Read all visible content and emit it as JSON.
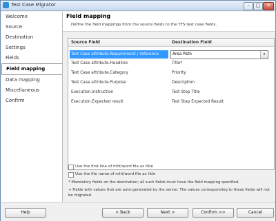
{
  "window": {
    "title": "Test Case Migrator"
  },
  "titlebar_buttons": {
    "minimize": "–",
    "maximize": "□",
    "close": "✕"
  },
  "sidebar": {
    "items": [
      {
        "label": "Welcome"
      },
      {
        "label": "Source"
      },
      {
        "label": "Destination"
      },
      {
        "label": "Settings"
      },
      {
        "label": "Fields"
      },
      {
        "label": "Field mapping",
        "active": true
      },
      {
        "label": "Data mapping"
      },
      {
        "label": "Miscellaneous"
      },
      {
        "label": "Confirm"
      }
    ]
  },
  "header": {
    "title": "Field mapping",
    "description": "Define the field mappings from the source fields to the TFS test case fields."
  },
  "grid": {
    "columns": [
      "Source Field",
      "Destination Field"
    ],
    "rows": [
      {
        "source": "Test Case attribute.Requirement / reference",
        "destination": "Area Path",
        "selected": true
      },
      {
        "source": "Test Case attribute.Headline",
        "destination": "Title*"
      },
      {
        "source": "Test Case attribute.Category",
        "destination": "Priority"
      },
      {
        "source": "Test Case attribute.Purpose",
        "destination": "Description"
      },
      {
        "source": "Execution.Instruction",
        "destination": "Test Step Title"
      },
      {
        "source": "Execution.Expected result",
        "destination": "Test Step Expected Result"
      }
    ],
    "dropdown_arrow": "▾"
  },
  "options": {
    "first_line_title": "Use the first line of mht/word file as title",
    "file_name_title": "Use the file name of mht/word file as title"
  },
  "notes": {
    "mandatory": "* Mandatory fields on the destination; all such fields must have the field mapping specified.",
    "auto_generated": "+ Fields with values that are auto-generated by the server. The values corresponding to these fields will not be migrated."
  },
  "footer": {
    "help": "Help",
    "back": "< Back",
    "next": "Next >",
    "confirm": "Confirm >>",
    "cancel": "Cancel"
  }
}
